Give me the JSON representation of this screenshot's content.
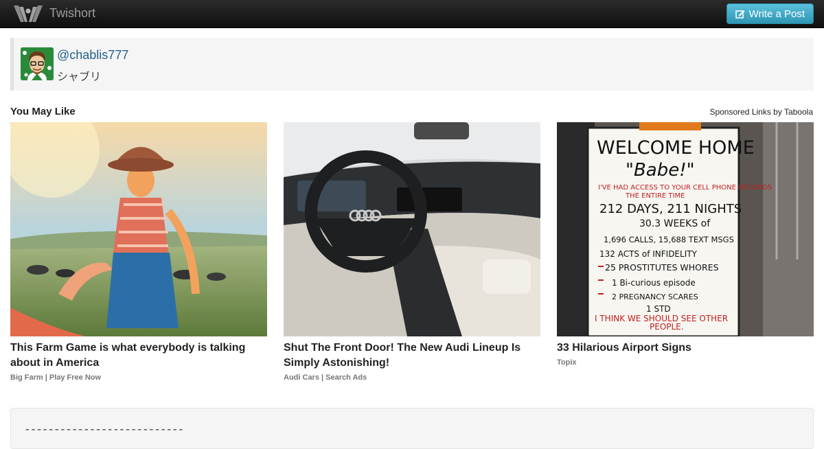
{
  "navbar": {
    "brand": "Twishort",
    "write_button": "Write a Post",
    "logo_icon": "twishort-wings-logo",
    "write_icon": "edit-icon"
  },
  "profile": {
    "handle": "@chablis777",
    "display_name": "シャブリ"
  },
  "recommendations": {
    "title": "You May Like",
    "sponsored": "Sponsored Links by Taboola",
    "items": [
      {
        "headline": "This Farm Game is what everybody is talking about in America",
        "source": "Big Farm | Play Free Now"
      },
      {
        "headline": "Shut The Front Door! The New Audi Lineup Is Simply Astonishing!",
        "source": "Audi Cars | Search Ads"
      },
      {
        "headline": "33 Hilarious Airport Signs",
        "source": "Topix",
        "sign": {
          "l1": "WELCOME HOME",
          "l2": "\"Babe!\"",
          "l3": "I'VE HAD ACCESS TO YOUR CELL PHONE RECORDS",
          "l4": "THE ENTIRE TIME",
          "l5": "212 DAYS, 211 NIGHTS",
          "l6": "30.3 WEEKS of",
          "l7": "1,696 CALLS, 15,688 TEXT MSGS",
          "l8": "132 ACTS of INFIDELITY",
          "l9": "25 PROSTITUTES WHORES",
          "l10": "1 Bi-curious episode",
          "l11": "2 PREGNANCY SCARES",
          "l12": "1 STD",
          "l13": "I THINK WE SHOULD SEE OTHER",
          "l14": "PEOPLE."
        }
      }
    ]
  },
  "post": {
    "text": "---------------------------"
  },
  "colors": {
    "accent": "#2f96b4",
    "link": "#1f5f8b",
    "navbar": "#1b1b1b"
  }
}
